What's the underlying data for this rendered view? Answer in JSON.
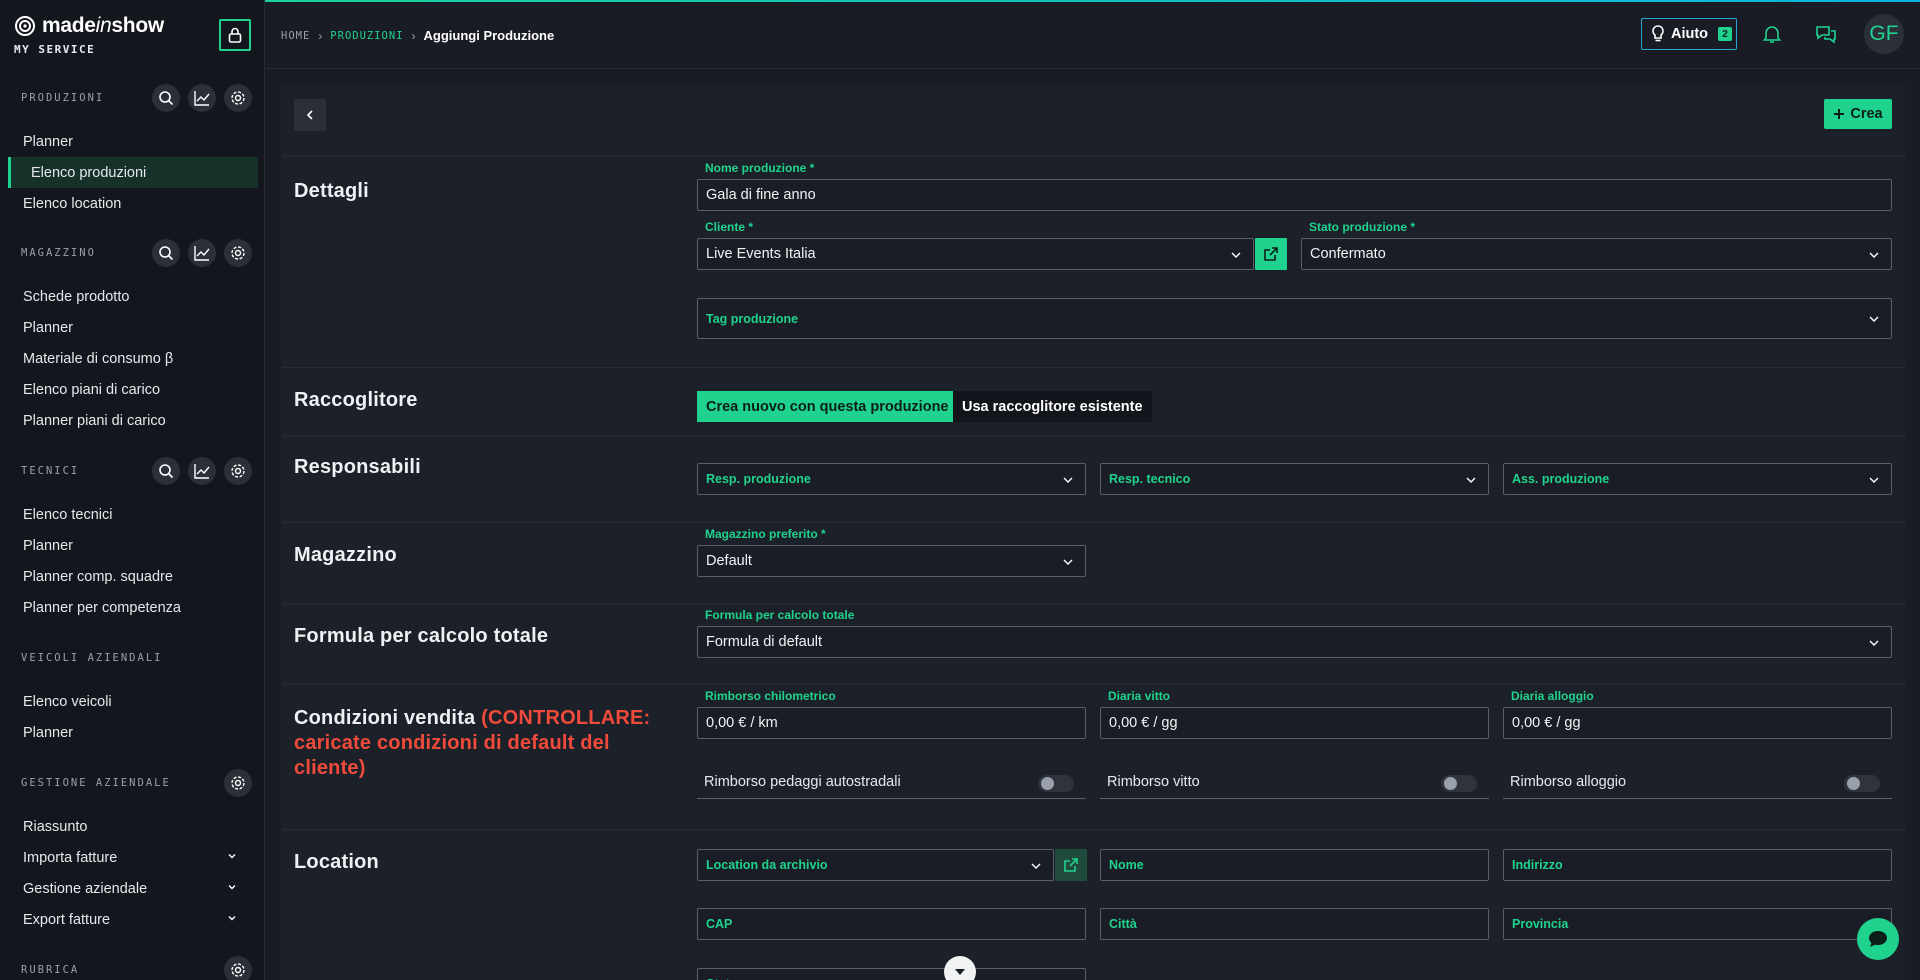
{
  "app": {
    "brand_pre": "made",
    "brand_italic": "in",
    "brand_post": "show",
    "brand_sub": "MY SERVICE"
  },
  "colors": {
    "accent": "#1fd38f",
    "warning": "#ef4a3a",
    "help_border": "#28a7d8"
  },
  "sidebar": {
    "sections": [
      {
        "title": "PRODUZIONI",
        "items": [
          "Planner",
          "Elenco produzioni",
          "Elenco location"
        ]
      },
      {
        "title": "MAGAZZINO",
        "items": [
          "Schede prodotto",
          "Planner",
          "Materiale di consumo β",
          "Elenco piani di carico",
          "Planner piani di carico"
        ]
      },
      {
        "title": "TECNICI",
        "items": [
          "Elenco tecnici",
          "Planner",
          "Planner comp. squadre",
          "Planner per competenza"
        ]
      },
      {
        "title": "VEICOLI AZIENDALI",
        "items": [
          "Elenco veicoli",
          "Planner"
        ]
      },
      {
        "title": "GESTIONE AZIENDALE",
        "items": [
          "Riassunto",
          "Importa fatture",
          "Gestione aziendale",
          "Export fatture"
        ]
      },
      {
        "title": "RUBRICA",
        "items": []
      }
    ],
    "active_item": "Elenco produzioni"
  },
  "header": {
    "breadcrumb": {
      "home": "HOME",
      "section": "PRODUZIONI",
      "current": "Aggiungi Produzione",
      "separator": "›"
    },
    "help_label": "Aiuto",
    "help_badge": "2",
    "avatar_initials": "GF"
  },
  "toolbar": {
    "create_label": "Crea"
  },
  "sections": {
    "dettagli": {
      "title": "Dettagli",
      "name_label": "Nome produzione *",
      "name_value": "Gala di fine anno",
      "client_label": "Cliente *",
      "client_value": "Live Events Italia",
      "status_label": "Stato produzione *",
      "status_value": "Confermato",
      "tags_placeholder": "Tag produzione"
    },
    "raccoglitore": {
      "title": "Raccoglitore",
      "option_new": "Crea nuovo con questa produzione",
      "option_existing": "Usa raccoglitore esistente"
    },
    "responsabili": {
      "title": "Responsabili",
      "resp_prod": "Resp. produzione",
      "resp_tech": "Resp. tecnico",
      "ass_prod": "Ass. produzione"
    },
    "magazzino": {
      "title": "Magazzino",
      "label": "Magazzino preferito *",
      "value": "Default"
    },
    "formula": {
      "title": "Formula per calcolo totale",
      "label": "Formula per calcolo totale",
      "value": "Formula di default"
    },
    "condizioni": {
      "title": "Condizioni vendita",
      "warning_line1": "(CONTROLLARE:",
      "warning_line2": "caricate condizioni di default del",
      "warning_line3": "cliente)",
      "km_label": "Rimborso chilometrico",
      "km_value": "0,00 € / km",
      "vitto_label": "Diaria vitto",
      "vitto_value": "0,00 € / gg",
      "alloggio_label": "Diaria alloggio",
      "alloggio_value": "0,00 € / gg",
      "toggle_pedaggi": "Rimborso pedaggi autostradali",
      "toggle_vitto": "Rimborso vitto",
      "toggle_alloggio": "Rimborso alloggio"
    },
    "location": {
      "title": "Location",
      "archive": "Location da archivio",
      "name": "Nome",
      "address": "Indirizzo",
      "cap": "CAP",
      "city": "Città",
      "province": "Provincia",
      "state_partial": "Stato"
    }
  }
}
